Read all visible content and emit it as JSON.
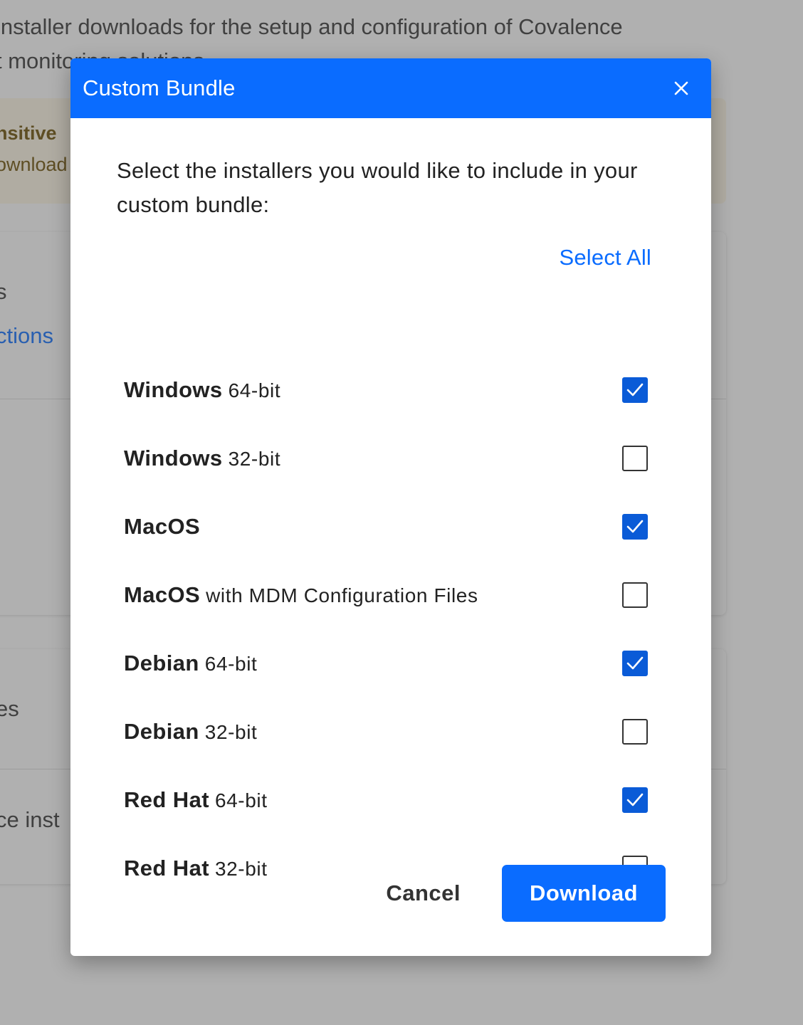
{
  "background": {
    "intro_line1": "installer downloads for the setup and configuration of Covalence",
    "intro_line2": "t monitoring solutions",
    "alert_title": "nsitive",
    "alert_text": "ownload",
    "card1_heading": "s",
    "card1_link": "ctions",
    "card2_heading": "es",
    "card2_text": "ce inst"
  },
  "modal": {
    "title": "Custom Bundle",
    "description": "Select the installers you would like to include in your custom bundle:",
    "select_all_label": "Select All",
    "options": [
      {
        "name": "Windows",
        "detail": "64-bit",
        "checked": true
      },
      {
        "name": "Windows",
        "detail": "32-bit",
        "checked": false
      },
      {
        "name": "MacOS",
        "detail": "",
        "checked": true
      },
      {
        "name": "MacOS",
        "detail": "with MDM Configuration Files",
        "checked": false
      },
      {
        "name": "Debian",
        "detail": "64-bit",
        "checked": true
      },
      {
        "name": "Debian",
        "detail": "32-bit",
        "checked": false
      },
      {
        "name": "Red Hat",
        "detail": "64-bit",
        "checked": true
      },
      {
        "name": "Red Hat",
        "detail": "32-bit",
        "checked": false
      }
    ],
    "cancel_label": "Cancel",
    "download_label": "Download"
  },
  "colors": {
    "accent": "#0a6cff",
    "checkbox_checked": "#0a5bd7"
  },
  "icons": {
    "close": "close-icon",
    "check": "checkmark-icon"
  }
}
